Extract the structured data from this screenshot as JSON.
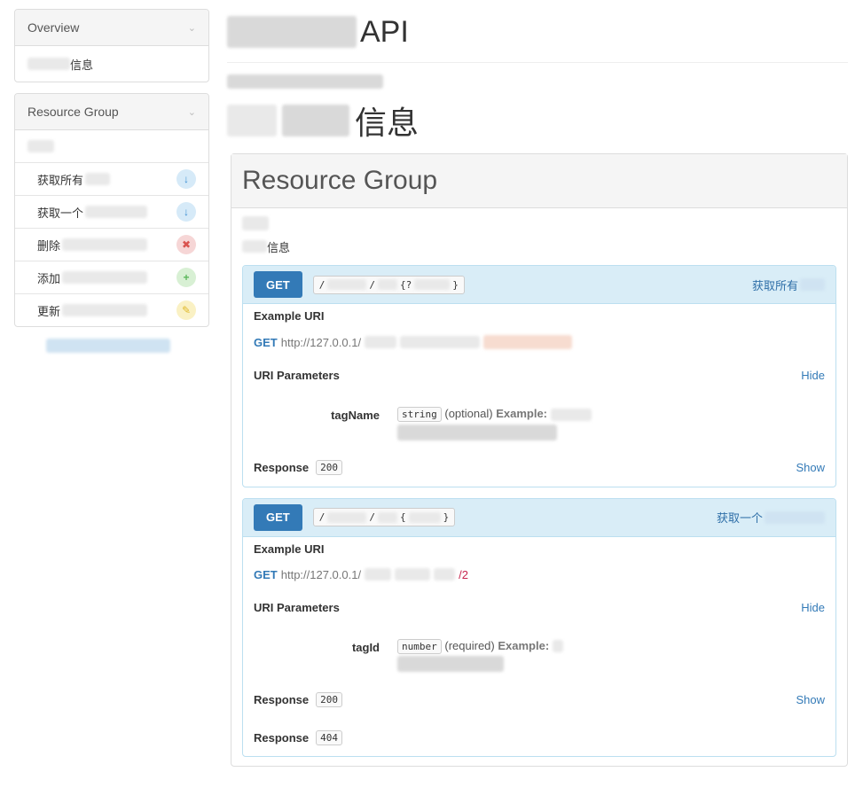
{
  "sidebar": {
    "overview": {
      "title": "Overview",
      "item_label": "信息"
    },
    "resource_group": {
      "title": "Resource Group",
      "items": [
        {
          "label": "获取所有",
          "type": "get"
        },
        {
          "label": "获取一个",
          "type": "get"
        },
        {
          "label": "删除",
          "type": "delete"
        },
        {
          "label": "添加",
          "type": "add"
        },
        {
          "label": "更新",
          "type": "update"
        }
      ]
    }
  },
  "main": {
    "api_title": "API",
    "info_title": "信息",
    "group_title": "Resource Group",
    "group_sub": "信息",
    "actions": [
      {
        "method": "GET",
        "uri_parts": [
          "/",
          "/",
          "{?"
        ],
        "uri_end": "}",
        "link": "获取所有",
        "example_uri_label": "Example URI",
        "example_get": "GET",
        "example_host": "http://127.0.0.1/",
        "example_tail": "",
        "params_label": "URI Parameters",
        "params_toggle": "Hide",
        "param_name": "tagName",
        "param_type": "string",
        "param_req": "(optional)",
        "param_example_label": "Example:",
        "responses": [
          {
            "label": "Response",
            "code": "200",
            "toggle": "Show"
          }
        ]
      },
      {
        "method": "GET",
        "uri_parts": [
          "/",
          "/",
          "{"
        ],
        "uri_end": "}",
        "link": "获取一个",
        "example_uri_label": "Example URI",
        "example_get": "GET",
        "example_host": "http://127.0.0.1/",
        "example_tail": "/2",
        "params_label": "URI Parameters",
        "params_toggle": "Hide",
        "param_name": "tagId",
        "param_type": "number",
        "param_req": "(required)",
        "param_example_label": "Example:",
        "responses": [
          {
            "label": "Response",
            "code": "200",
            "toggle": "Show"
          },
          {
            "label": "Response",
            "code": "404",
            "toggle": ""
          }
        ]
      }
    ]
  },
  "icons": {
    "get": "arrow-down-icon",
    "delete": "close-icon",
    "add": "plus-icon",
    "update": "pencil-icon"
  }
}
